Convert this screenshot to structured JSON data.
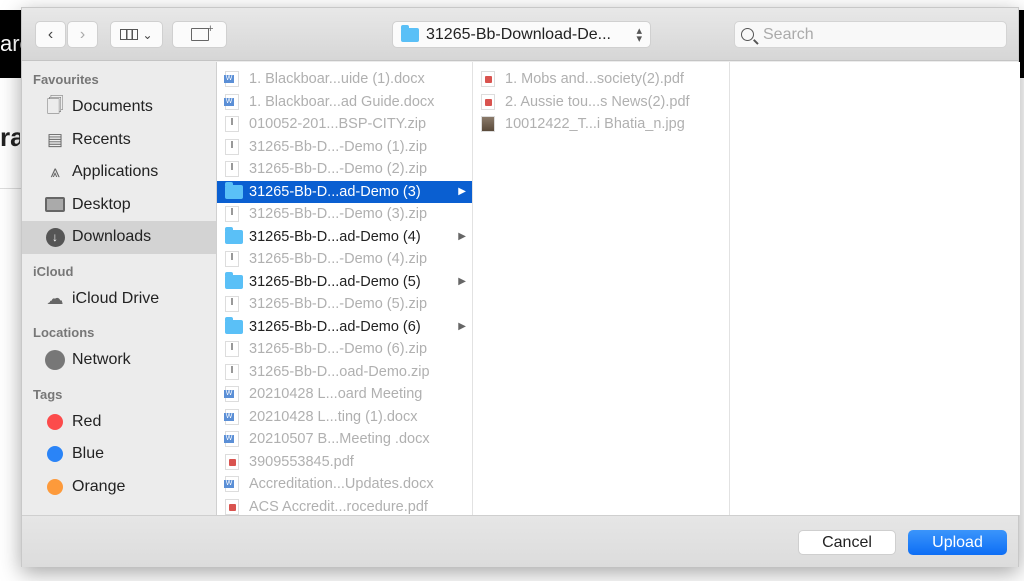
{
  "background": {
    "left_text": "are",
    "left_heading": "ra"
  },
  "toolbar": {
    "back_icon": "chevron-left",
    "forward_icon": "chevron-right",
    "view_icon": "column-view",
    "new_folder_icon": "folder-plus",
    "path": "31265-Bb-Download-De...",
    "search_placeholder": "Search"
  },
  "sidebar": {
    "favourites_label": "Favourites",
    "favourites": [
      {
        "label": "Documents",
        "icon": "documents"
      },
      {
        "label": "Recents",
        "icon": "clock"
      },
      {
        "label": "Applications",
        "icon": "applications"
      },
      {
        "label": "Desktop",
        "icon": "desktop"
      },
      {
        "label": "Downloads",
        "icon": "download",
        "selected": true
      }
    ],
    "icloud_label": "iCloud",
    "icloud": [
      {
        "label": "iCloud Drive",
        "icon": "cloud"
      }
    ],
    "locations_label": "Locations",
    "locations": [
      {
        "label": "Network",
        "icon": "globe"
      }
    ],
    "tags_label": "Tags",
    "tags": [
      {
        "label": "Red",
        "color": "#fc4b4b"
      },
      {
        "label": "Blue",
        "color": "#2a84f7"
      },
      {
        "label": "Orange",
        "color": "#fd9a3b"
      }
    ]
  },
  "column1": [
    {
      "name": "1. Blackboar...uide (1).docx",
      "type": "doc"
    },
    {
      "name": "1. Blackboar...ad Guide.docx",
      "type": "doc"
    },
    {
      "name": "010052-201...BSP-CITY.zip",
      "type": "zip"
    },
    {
      "name": "31265-Bb-D...-Demo (1).zip",
      "type": "zip"
    },
    {
      "name": "31265-Bb-D...-Demo (2).zip",
      "type": "zip"
    },
    {
      "name": "31265-Bb-D...ad-Demo (3)",
      "type": "folder",
      "selected": true
    },
    {
      "name": "31265-Bb-D...-Demo (3).zip",
      "type": "zip"
    },
    {
      "name": "31265-Bb-D...ad-Demo (4)",
      "type": "folder"
    },
    {
      "name": "31265-Bb-D...-Demo (4).zip",
      "type": "zip"
    },
    {
      "name": "31265-Bb-D...ad-Demo (5)",
      "type": "folder"
    },
    {
      "name": "31265-Bb-D...-Demo (5).zip",
      "type": "zip"
    },
    {
      "name": "31265-Bb-D...ad-Demo (6)",
      "type": "folder"
    },
    {
      "name": "31265-Bb-D...-Demo (6).zip",
      "type": "zip"
    },
    {
      "name": "31265-Bb-D...oad-Demo.zip",
      "type": "zip"
    },
    {
      "name": "20210428 L...oard Meeting",
      "type": "doc"
    },
    {
      "name": "20210428 L...ting  (1).docx",
      "type": "doc"
    },
    {
      "name": "20210507 B...Meeting .docx",
      "type": "doc"
    },
    {
      "name": "3909553845.pdf",
      "type": "pdf"
    },
    {
      "name": "Accreditation...Updates.docx",
      "type": "doc"
    },
    {
      "name": "ACS Accredit...rocedure.pdf",
      "type": "pdf"
    }
  ],
  "column2": [
    {
      "name": "1. Mobs and...society(2).pdf",
      "type": "pdf"
    },
    {
      "name": "2. Aussie tou...s News(2).pdf",
      "type": "pdf"
    },
    {
      "name": "10012422_T...i Bhatia_n.jpg",
      "type": "img"
    }
  ],
  "buttons": {
    "cancel": "Cancel",
    "upload": "Upload"
  },
  "colors": {
    "accent": "#0a5fd1",
    "upload": "#1a78f7"
  }
}
